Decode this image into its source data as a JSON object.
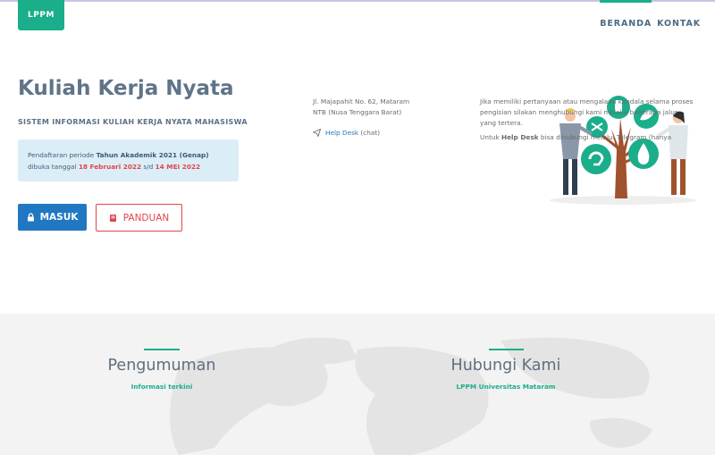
{
  "header": {
    "logo": "LPPM",
    "nav": [
      {
        "label": "BERANDA",
        "active": true
      },
      {
        "label": "KONTAK",
        "active": false
      }
    ]
  },
  "hero": {
    "title": "Kuliah Kerja Nyata",
    "subtitle": "SISTEM INFORMASI KULIAH KERJA NYATA MAHASISWA",
    "notice": {
      "line1_prefix": "Pendaftaran periode ",
      "period": "Tahun Akademik 2021 (Genap)",
      "line2_prefix": "dibuka tanggal ",
      "start_date": "18 Februari 2022",
      "separator": " s/d ",
      "end_date": "14 MEI 2022"
    },
    "buttons": {
      "masuk": "MASUK",
      "panduan": "PANDUAN"
    }
  },
  "announcements": {
    "title": "Pengumuman",
    "subtitle": "Informasi terkini"
  },
  "contact": {
    "title": "Hubungi Kami",
    "subtitle": "LPPM Universitas Mataram",
    "address_line1": "Jl. Majapahit No. 62, Mataram",
    "address_line2": "NTB (Nusa Tenggara Barat)",
    "helpdesk_label": "Help Desk",
    "helpdesk_suffix": " (chat)",
    "intro": "Jika memiliki pertanyaan atau mengalami kendala selama proses pengisian silakan menghubungi kami melalui beberapa jalur yang tertera.",
    "telegram_prefix": "Untuk ",
    "telegram_bold": "Help Desk",
    "telegram_rest": " bisa dihubungi melalui Telegram (hanya"
  },
  "colors": {
    "brand": "#1aae8a",
    "primary": "#2178c2",
    "danger": "#e0454c",
    "notice_bg": "#dbedf7"
  }
}
